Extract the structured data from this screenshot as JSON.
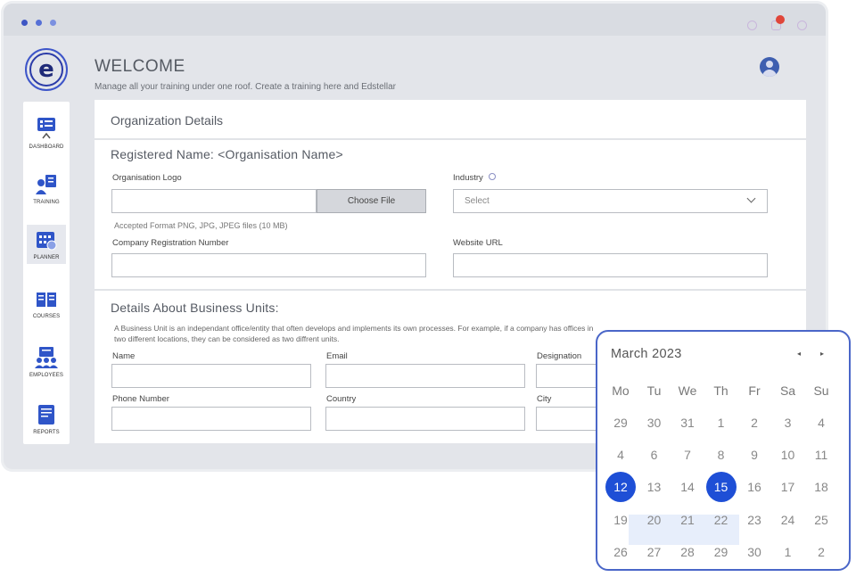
{
  "header": {
    "title": "WELCOME",
    "subtitle": "Manage all your training under one roof. Create a training here and Edstellar",
    "logo_letter": "e"
  },
  "sidebar": {
    "items": [
      {
        "label": "DASHBOARD",
        "icon": "dashboard-icon"
      },
      {
        "label": "TRAINING",
        "icon": "training-icon"
      },
      {
        "label": "PLANNER",
        "icon": "planner-icon",
        "active": true
      },
      {
        "label": "COURSES",
        "icon": "courses-icon"
      },
      {
        "label": "EMPLOYEES",
        "icon": "employees-icon"
      },
      {
        "label": "REPORTS",
        "icon": "reports-icon"
      }
    ]
  },
  "organization": {
    "card_title": "Organization Details",
    "registered_name": "Registered Name: <Organisation Name>",
    "logo_label": "Organisation Logo",
    "choose_file": "Choose File",
    "accepted_format": "Accepted Format PNG, JPG, JPEG files (10 MB)",
    "industry_label": "Industry",
    "industry_placeholder": "Select",
    "company_reg_label": "Company Registration Number",
    "website_label": "Website URL"
  },
  "business_units": {
    "title": "Details About Business Units:",
    "description": "A Business Unit is an independant office/entity that often develops and implements its own processes. For example, if a company has offices in two different locations, they can be considered as two diffrent units.",
    "name_label": "Name",
    "email_label": "Email",
    "designation_label": "Designation",
    "phone_label": "Phone Number",
    "country_label": "Country",
    "city_label": "City"
  },
  "calendar": {
    "month": "March 2023",
    "prev": "◂",
    "next": "▸",
    "weekdays": [
      "Mo",
      "Tu",
      "We",
      "Th",
      "Fr",
      "Sa",
      "Su"
    ],
    "weeks": [
      [
        "29",
        "30",
        "31",
        "1",
        "2",
        "3",
        "4"
      ],
      [
        "4",
        "6",
        "7",
        "8",
        "9",
        "10",
        "11"
      ],
      [
        "12",
        "13",
        "14",
        "15",
        "16",
        "17",
        "18"
      ],
      [
        "19",
        "20",
        "21",
        "22",
        "23",
        "24",
        "25"
      ],
      [
        "26",
        "27",
        "28",
        "29",
        "30",
        "1",
        "2"
      ]
    ],
    "range_start": "12",
    "range_end": "15",
    "accent_color": "#1e4fd6"
  },
  "colors": {
    "accent": "#3d55c9",
    "notification": "#e0463a"
  }
}
